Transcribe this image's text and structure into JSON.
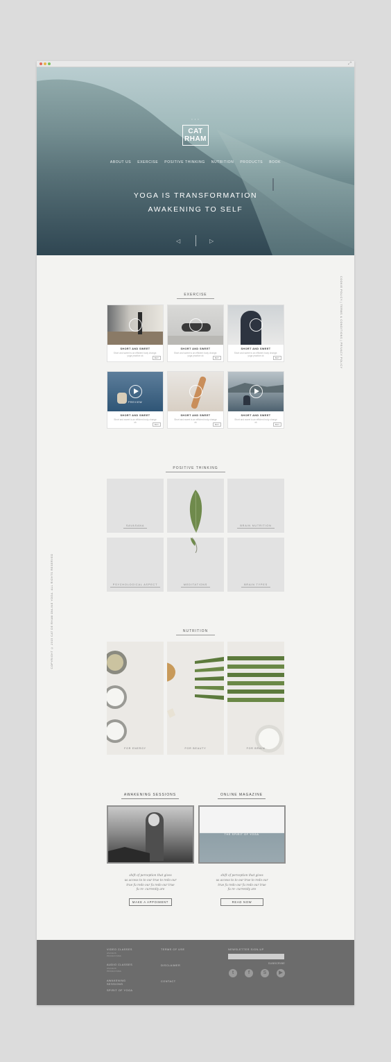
{
  "hero": {
    "brand": "CAT\nRHAM",
    "nav": [
      "ABOUT US",
      "EXERCISE",
      "POSITIVE THINKING",
      "NUTRITION",
      "PRODUCTS",
      "BOOK"
    ],
    "tagline_1": "YOGA IS TRANSFORMATION",
    "tagline_2": "AWAKENING TO SELF",
    "prev": "◁",
    "next": "▷"
  },
  "side": {
    "right": "COOKIE POLICY  |  TERMS & CONDITIONS  |  PRIVACY POLICY",
    "left": "COPYRIGHT © 2015 CAT DE RHAM ONLINE YOGA. ALL RIGHTS RESERVED"
  },
  "exercise": {
    "title": "EXERCISE",
    "cards": [
      {
        "title": "SHORT AND SWEET",
        "desc": "Short and sweet is an efficient body change. yoga practice ok",
        "buy": "BUY",
        "preview": ""
      },
      {
        "title": "SHORT AND SWEET",
        "desc": "Short and sweet is an efficient body change. yoga practice ok",
        "buy": "BUY",
        "preview": ""
      },
      {
        "title": "SHORT AND SWEET",
        "desc": "Short and sweet is an efficient body change. yoga practice ok",
        "buy": "BUY",
        "preview": ""
      },
      {
        "title": "SHORT AND SWEET",
        "desc": "Short and sweet is an efficient body change ok",
        "buy": "BUY",
        "preview": "PREVIEW"
      },
      {
        "title": "SHORT AND SWEET",
        "desc": "Short and sweet is an efficient body change ok",
        "buy": "BUY",
        "preview": ""
      },
      {
        "title": "SHORT AND SWEET",
        "desc": "Short and sweet is an efficient body change ok",
        "buy": "BUY",
        "preview": ""
      }
    ]
  },
  "positive": {
    "title": "POSITIVE THINKING",
    "tiles": [
      "SAVASANA",
      "",
      "BRAIN NUTRITION",
      "PSYCHOLOGICAL ASPECT",
      "MEDITATIONS",
      "BRAIN TYPES"
    ]
  },
  "nutrition": {
    "title": "NUTRITION",
    "tiles": [
      "FOR ENERGY",
      "FOR BEAUTY",
      "FOR BRAIN"
    ]
  },
  "sessions": {
    "title": "AWAKENING SESSIONS",
    "quote": [
      "shift of perception that gives",
      "us access to to our true to redo our",
      "true fu redo our fu redo our true",
      "fu re- currently are"
    ],
    "button": "MAKE A APPOIMENT"
  },
  "magazine": {
    "title": "ONLINE MAGAZINE",
    "overlay": "THE SPIRIT OF YOGA",
    "quote": [
      "shift of perception that gives",
      "us access to to our true to redo our",
      "true fu redo our fu redo our true",
      "fu re- currently are"
    ],
    "button": "READ NOW"
  },
  "footer": {
    "col1": [
      "VIDEO CLASSES",
      "AUDIO CLASSES",
      "AWAKENING SESSIONS",
      "SPIRIT OF YOGA"
    ],
    "col1_sub": [
      "ASANAS PRANAYAMA",
      "ASANAS PRANAYAMA"
    ],
    "col2": [
      "TERMS OF USE",
      "DISCLAIMER",
      "CONTACT"
    ],
    "newsletter": "NEWSLETTER SIGN-UP",
    "subscribe": "SUBSCRIBE",
    "social": [
      "twitter-icon",
      "facebook-icon",
      "skype-icon",
      "youtube-icon"
    ]
  }
}
